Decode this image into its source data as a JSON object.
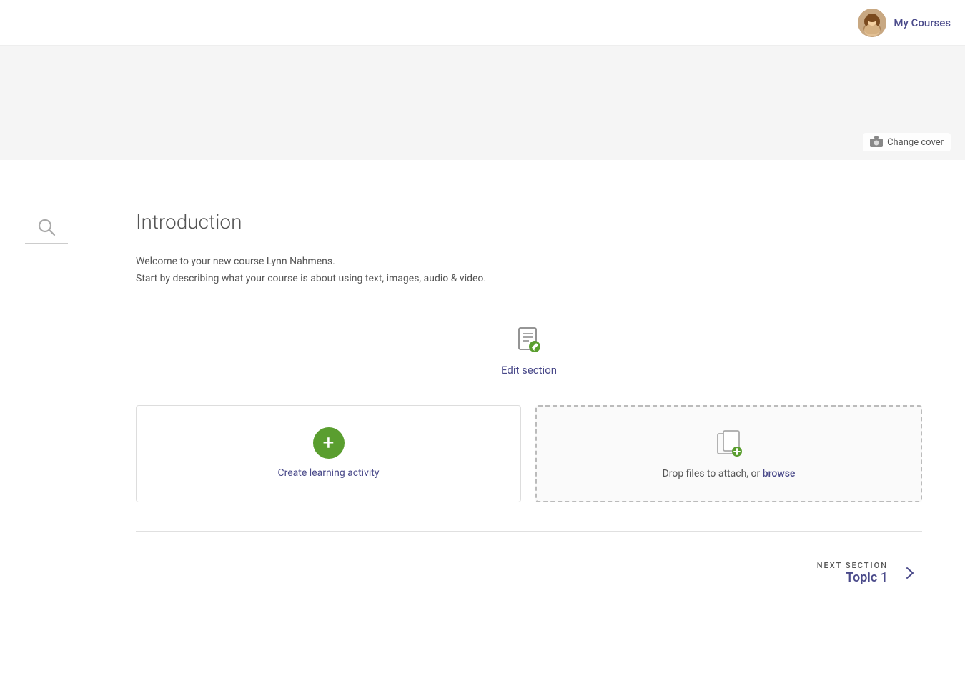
{
  "header": {
    "my_courses_label": "My Courses",
    "change_cover_label": "Change cover"
  },
  "section": {
    "title": "Introduction",
    "intro_line1": "Welcome to your new course Lynn Nahmens.",
    "intro_line2": "Start by describing what your course is about using text, images, audio & video."
  },
  "edit_section": {
    "label": "Edit section"
  },
  "create_activity": {
    "label": "Create learning activity"
  },
  "drop_files": {
    "text_before": "Drop files to attach, or ",
    "browse_label": "browse"
  },
  "next_section": {
    "label": "NEXT SECTION",
    "topic": "Topic 1"
  },
  "colors": {
    "accent": "#4a4a8a",
    "green": "#5a9e2f"
  }
}
